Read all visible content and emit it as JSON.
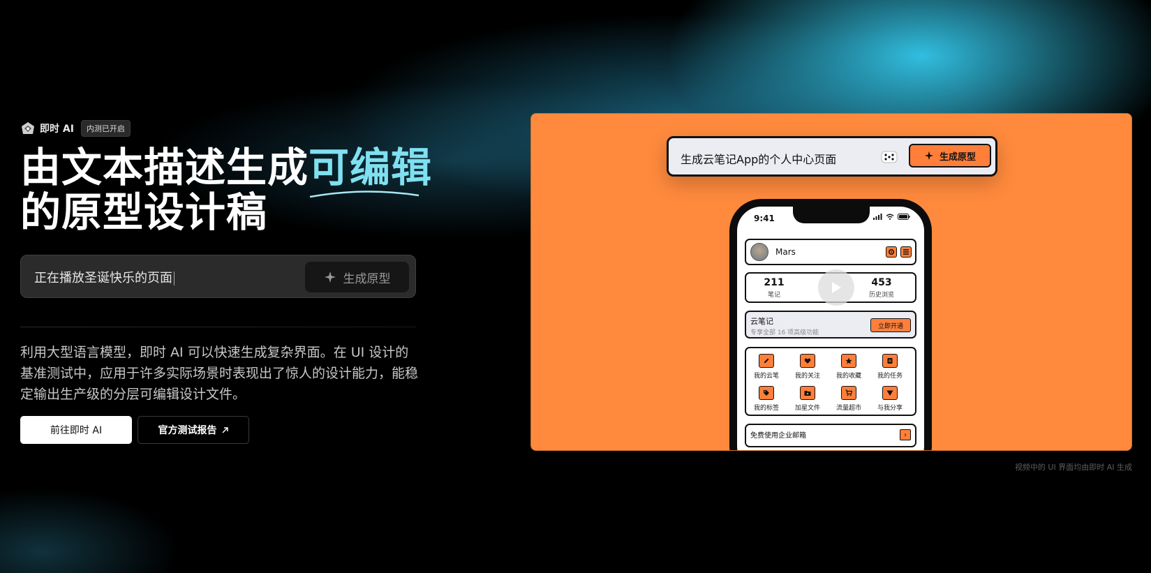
{
  "brand": {
    "name": "即时 AI",
    "badge": "内测已开启"
  },
  "hero": {
    "title_part1": "由文本描述生成",
    "title_accent": "可编辑",
    "title_line2": "的原型设计稿"
  },
  "prompt": {
    "text": "正在播放圣诞快乐的页面",
    "button_label": "生成原型"
  },
  "description": "利用大型语言模型，即时 AI 可以快速生成复杂界面。在 UI 设计的基准测试中，应用于许多实际场景时表现出了惊人的设计能力，能稳定输出生产级的分层可编辑设计文件。",
  "buttons": {
    "primary_label": "前往即时 AI",
    "secondary_label": "官方测试报告"
  },
  "demo": {
    "prompt_text": "生成云笔记App的个人中心页面",
    "button_label": "生成原型",
    "accent_color": "#ff8a3d",
    "phone": {
      "time": "9:41",
      "profile_name": "Mars",
      "stats": [
        {
          "value": "211",
          "label": "笔记"
        },
        {
          "value": "453",
          "label": "历史浏览"
        }
      ],
      "vip": {
        "title": "云笔记",
        "subtitle": "专享全部 16 项高级功能",
        "button": "立即开通"
      },
      "grid": [
        {
          "label": "我的云笔",
          "icon": "edit-icon"
        },
        {
          "label": "我的关注",
          "icon": "heart-icon"
        },
        {
          "label": "我的收藏",
          "icon": "star-icon"
        },
        {
          "label": "我的任务",
          "icon": "task-icon"
        },
        {
          "label": "我的标签",
          "icon": "tag-icon"
        },
        {
          "label": "加星文件",
          "icon": "starred-folder-icon"
        },
        {
          "label": "流量超市",
          "icon": "cart-icon"
        },
        {
          "label": "与我分享",
          "icon": "share-icon"
        }
      ],
      "mail_label": "免费使用企业邮箱"
    }
  },
  "caption": "视频中的 UI 界面均由即时 AI 生成"
}
